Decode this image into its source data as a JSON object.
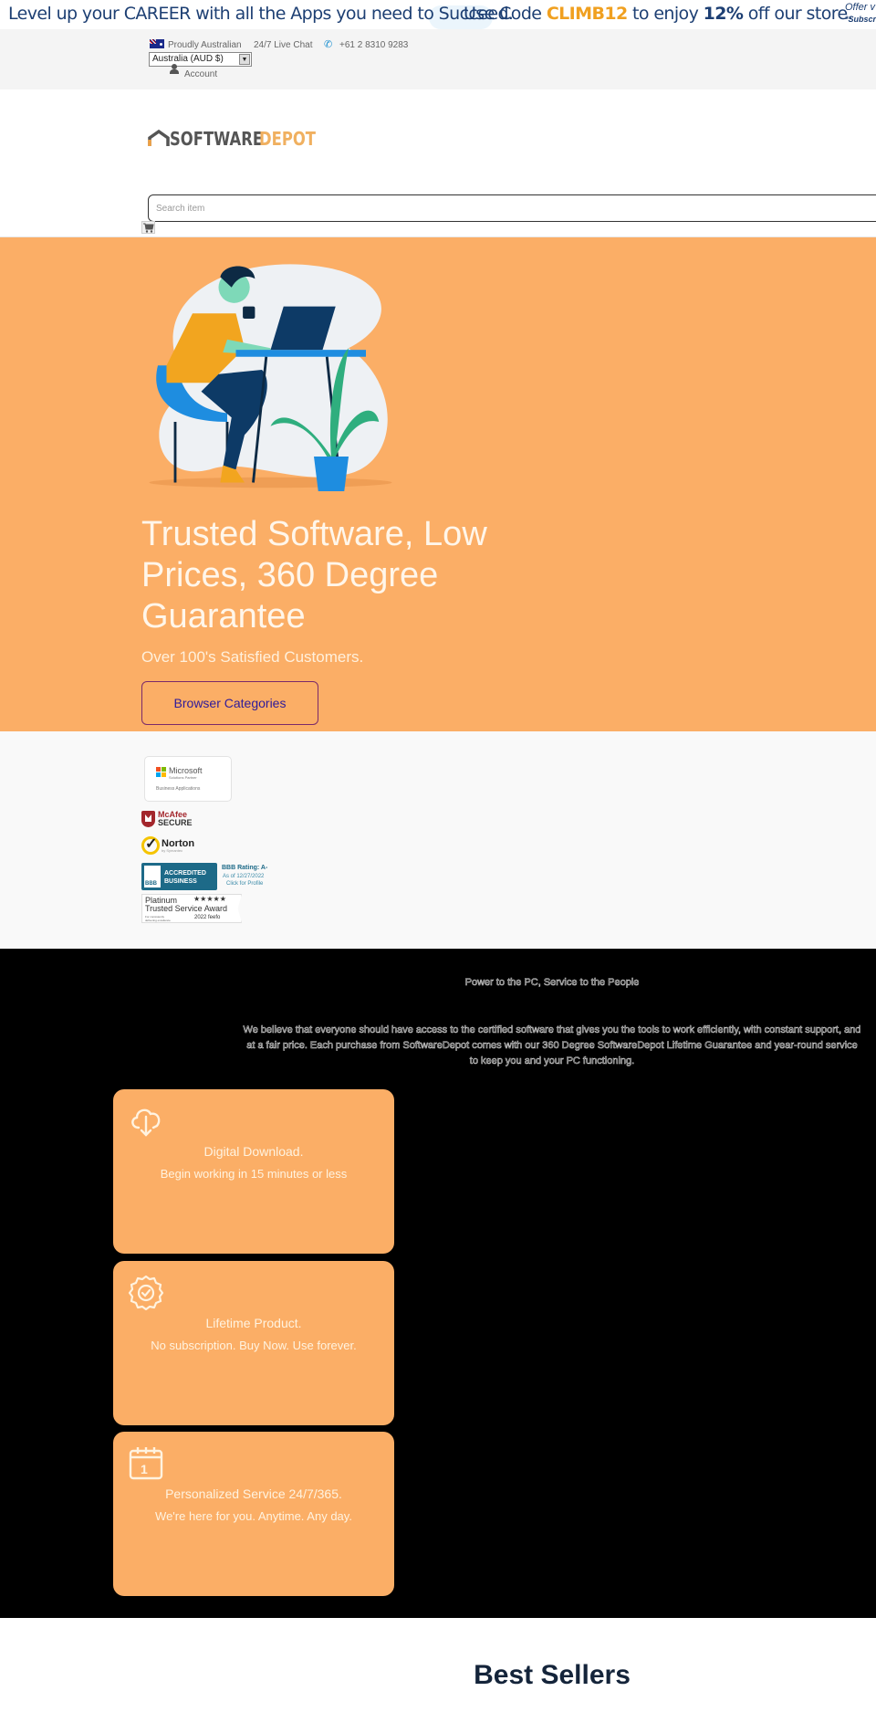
{
  "promo": {
    "part1": "Level up your CAREER with all the Apps you need to Succeed.",
    "part2_prefix": "Use Code ",
    "code": "CLIMB12",
    "part2_mid": " to enjoy ",
    "percent": "12%",
    "part2_suffix": " off our store.",
    "side_line1": "Offer v",
    "side_line2": "*Subscri",
    "code_color": "#f0a020",
    "text_color": "#1d3f73"
  },
  "utility": {
    "proudly": "Proudly Australian",
    "chat": "24/7 Live Chat",
    "phone": "+61 2 8310 9283",
    "currency_selected": "Australia (AUD $)",
    "account": "Account"
  },
  "header": {
    "logo_part1": "SOFTWARE",
    "logo_part2": "DEPOT",
    "search_placeholder": "Search item"
  },
  "hero": {
    "title": "Trusted Software, Low Prices, 360 Degree Guarantee",
    "subtitle": "Over 100's Satisfied Customers.",
    "button": "Browser Categories",
    "bg_color": "#fbae66"
  },
  "badges": {
    "microsoft": {
      "name": "Microsoft",
      "line2": "Solutions Partner",
      "line3": "Business Applications"
    },
    "mcafee": {
      "line1": "McAfee",
      "line2": "SECURE"
    },
    "norton": {
      "name": "Norton",
      "sub": "by Symantec"
    },
    "bbb": {
      "accredited": "ACCREDITED",
      "business": "BUSINESS",
      "rating": "BBB Rating: A-",
      "as_of": "As of 12/27/2022",
      "click": "Click for Profile"
    },
    "feefo": {
      "line1": "Platinum",
      "stars": "★★★★★",
      "line2": "Trusted Service Award",
      "line3": "For consistently delivering excellence",
      "year": "2022 feefo"
    }
  },
  "features": {
    "title": "Power to the PC, Service to the People",
    "description": "We believe that everyone should have access to the certified software that gives you the tools to work efficiently, with constant support, and at a fair price. Each purchase from SoftwareDepot comes with our 360 Degree SoftwareDepot Lifetime Guarantee and year-round service to keep you and your PC functioning.",
    "cards": [
      {
        "icon": "cloud-download-icon",
        "title": "Digital Download.",
        "subtitle": "Begin working in 15 minutes or less"
      },
      {
        "icon": "badge-check-icon",
        "title": "Lifetime Product.",
        "subtitle": "No subscription. Buy Now. Use forever."
      },
      {
        "icon": "calendar-icon",
        "title": "Personalized Service 24/7/365.",
        "subtitle": "We're here for you. Anytime. Any day."
      }
    ]
  },
  "best_sellers": {
    "title": "Best Sellers"
  }
}
